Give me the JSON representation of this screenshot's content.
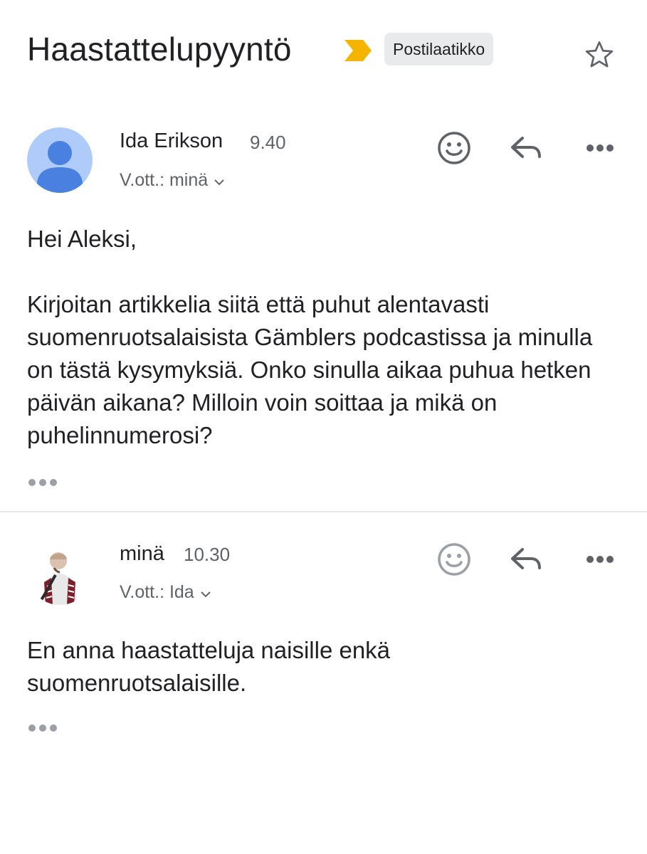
{
  "subject": {
    "title": "Haastattelupyyntö",
    "label": "Postilaatikko",
    "important_color": "#f4b400"
  },
  "messages": [
    {
      "sender": "Ida Erikson",
      "time": "9.40",
      "to": "V.ott.: minä",
      "avatar": "default-person-avatar",
      "body": "Hei Aleksi,\n\nKirjoitan artikkelia siitä että puhut alentavasti suomenruotsalaisista Gämblers podcastissa ja minulla on tästä kysymyksiä. Onko sinulla aikaa puhua hetken päivän aikana? Milloin voin soittaa ja mikä on puhelinnumerosi?"
    },
    {
      "sender": "minä",
      "time": "10.30",
      "to": "V.ott.: Ida",
      "avatar": "user-photo-avatar",
      "body": "En anna haastatteluja naisille enkä suomenruotsalaisille."
    }
  ],
  "colors": {
    "avatar_bg": "#aecbfa",
    "avatar_fg": "#4a80e0",
    "icon_gray": "#5f6368"
  }
}
